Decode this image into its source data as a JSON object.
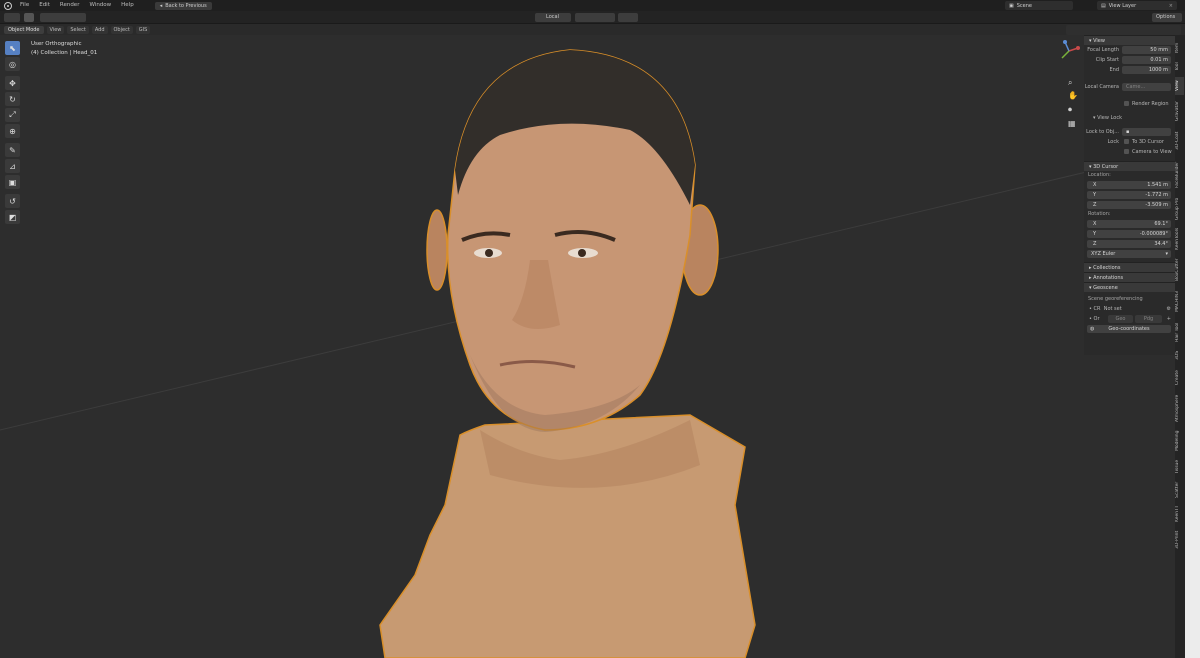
{
  "menu": {
    "items": [
      "File",
      "Edit",
      "Render",
      "Window",
      "Help"
    ],
    "back_label": "Back to Previous"
  },
  "scene": {
    "label": "Scene"
  },
  "view_layer": {
    "label": "View Layer"
  },
  "header": {
    "transform_orientation": "Local",
    "options_label": "Options"
  },
  "mode_bar": {
    "mode": "Object Mode",
    "items": [
      "View",
      "Select",
      "Add",
      "Object",
      "GIS"
    ]
  },
  "viewport": {
    "view_name": "User Orthographic",
    "collection_info": "(4) Collection | Head_01"
  },
  "npanel": {
    "view": {
      "header": "View",
      "focal_length_label": "Focal Length",
      "focal_length": "50 mm",
      "clip_start_label": "Clip Start",
      "clip_start": "0.01 m",
      "end_label": "End",
      "end": "1000 m",
      "local_camera_label": "Local Camera",
      "camera_placeholder": "Came...",
      "render_region_label": "Render Region"
    },
    "view_lock": {
      "header": "View Lock",
      "lock_to_obj_label": "Lock to Obj...",
      "lock_label": "Lock",
      "to_3d_cursor": "To 3D Cursor",
      "camera_to_view": "Camera to View"
    },
    "cursor": {
      "header": "3D Cursor",
      "location_label": "Location:",
      "loc_x": "1.541 m",
      "loc_y": "-1.772 m",
      "loc_z": "-3.509 m",
      "rotation_label": "Rotation:",
      "rot_x": "69.1°",
      "rot_y": "-0.000089°",
      "rot_z": "34.4°",
      "rotation_mode": "XYZ Euler"
    },
    "collapsed": [
      "Collections",
      "Annotations",
      "Geoscene"
    ],
    "geo": {
      "label": "Scene georeferencing",
      "crs_label": "CR",
      "not_set": "Not set",
      "or_label": "Or",
      "btn1": "Geo",
      "btn2": "Pdg",
      "geocoords": "Geo-coordinates"
    }
  },
  "tabs": [
    "Item",
    "Tool",
    "View",
    "Gravatar",
    "3D-Coat",
    "FaceBuilder",
    "Group Pro",
    "KeenTools",
    "BoxCutter",
    "MACHIN3",
    "Hair Tool",
    "3DS",
    "Create",
    "Atmosphere",
    "Modeling",
    "Tissue",
    "Scatter",
    "KeenTT",
    "3D-Print"
  ]
}
